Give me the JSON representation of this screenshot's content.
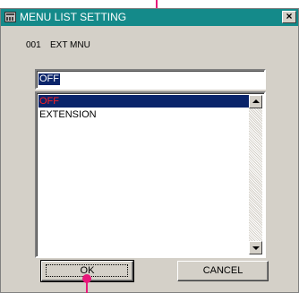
{
  "window": {
    "title": "MENU LIST SETTING",
    "close_label": "×"
  },
  "menu_info": {
    "number": "001",
    "name": "EXT MNU"
  },
  "edit_field": {
    "value": "OFF"
  },
  "list": {
    "items": [
      "OFF",
      "EXTENSION"
    ],
    "selected": "OFF"
  },
  "buttons": {
    "ok_label": "OK",
    "cancel_label": "CANCEL"
  },
  "colors": {
    "titlebar": "#148a8a",
    "selection": "#0a246a",
    "selected_text": "#ff2020",
    "callout": "#e8177a"
  }
}
